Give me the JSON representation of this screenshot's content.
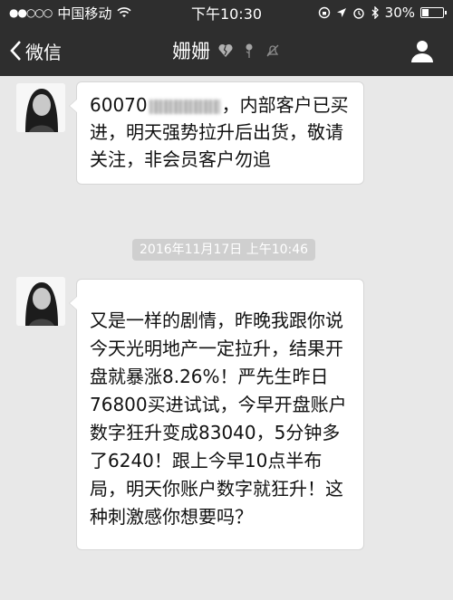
{
  "status_bar": {
    "signal": "●●○○○",
    "carrier": "中国移动",
    "time": "下午10:30",
    "battery": "30%",
    "battery_level": 0.3
  },
  "nav": {
    "back_label": "微信",
    "title": "姗姗"
  },
  "messages": [
    {
      "before_redaction": "60070",
      "after_redaction": "，内部客户已买进，明天强势拉升后出货，敬请关注，非会员客户勿追"
    },
    {
      "text": "又是一样的剧情，昨晚我跟你说今天光明地产一定拉升，结果开盘就暴涨8.26%！严先生昨日76800买进试试，今早开盘账户数字狂升变成83040，5分钟多了6240！跟上今早10点半布局，明天你账户数字就狂升！这种刺激感你想要吗？"
    }
  ],
  "timestamp": "2016年11月17日 上午10:46",
  "icons": [
    "wifi-icon",
    "lock-rotation-icon",
    "location-icon",
    "alarm-icon",
    "bluetooth-icon",
    "battery-icon",
    "back-chevron-icon",
    "broken-heart-icon",
    "rose-icon",
    "mute-icon",
    "profile-icon",
    "avatar"
  ]
}
